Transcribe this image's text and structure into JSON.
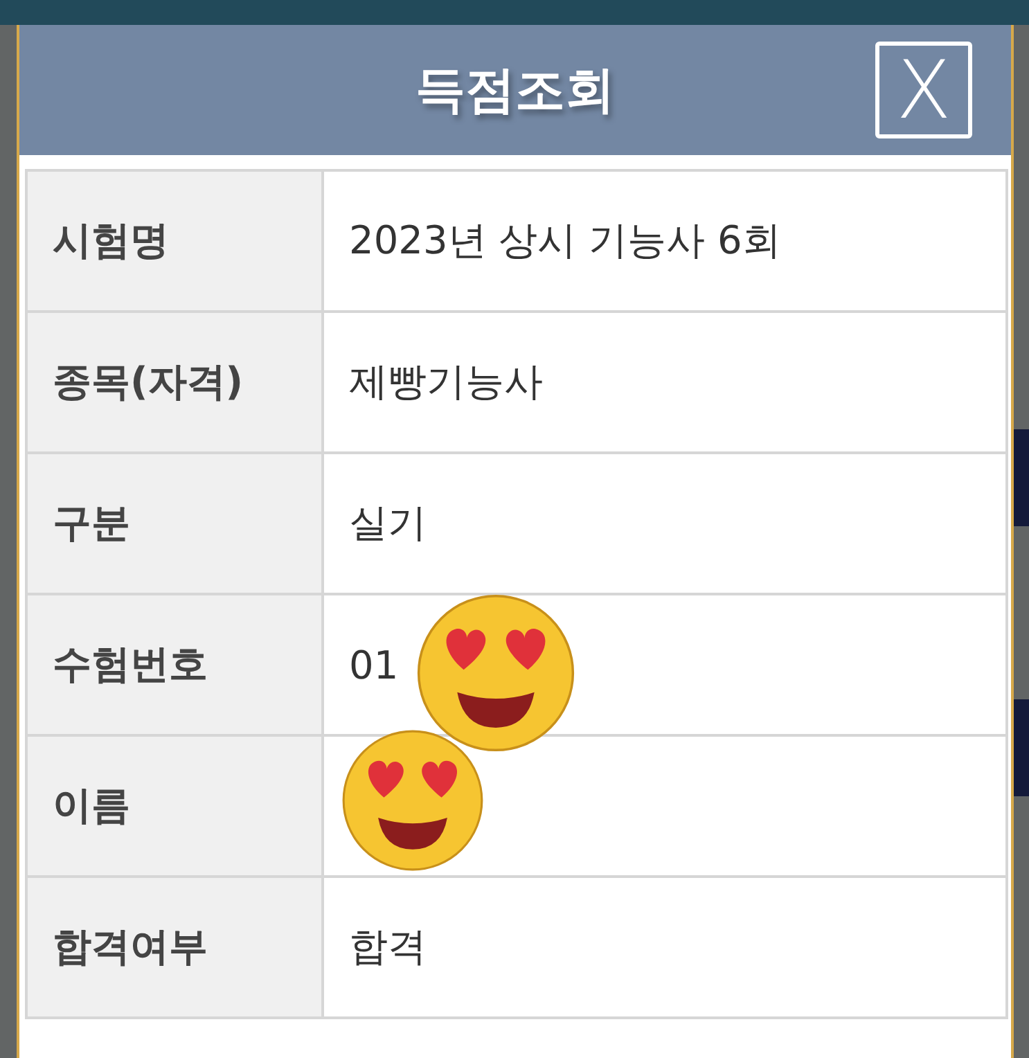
{
  "dialog": {
    "title": "득점조회",
    "close_label": "X"
  },
  "rows": [
    {
      "label": "시험명",
      "value": "2023년 상시 기능사 6회"
    },
    {
      "label": "종목(자격)",
      "value": "제빵기능사"
    },
    {
      "label": "구분",
      "value": "실기"
    },
    {
      "label": "수험번호",
      "value": "01"
    },
    {
      "label": "이름"
    },
    {
      "label": "합격여부",
      "value": "합격"
    }
  ]
}
